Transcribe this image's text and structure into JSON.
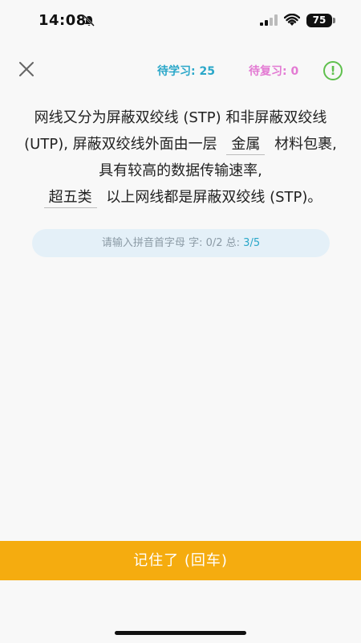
{
  "status_bar": {
    "time": "14:08",
    "battery": "75"
  },
  "header": {
    "close_icon": "close-icon",
    "to_learn": "待学习: 25",
    "to_review": "待复习: 0",
    "alert_icon": "!"
  },
  "passage": {
    "part1": "网线又分为屏蔽双绞线 (STP) 和非屏蔽双绞线 (UTP), 屏蔽双绞线外面由一层",
    "blank1": "金属",
    "part2": "材料包裹, 具有较高的数据传输速率,",
    "blank2": "超五类",
    "part3": "以上网线都是屏蔽双绞线 (STP)。"
  },
  "input": {
    "placeholder": "请输入拼音首字母",
    "char_progress": "字: 0/2",
    "total_label": "总:",
    "total_value": "3/5"
  },
  "footer": {
    "remember_label": "记住了 (回车)"
  },
  "colors": {
    "learn": "#2aa7c9",
    "review": "#e37ad3",
    "accent_green": "#5fc04d",
    "button": "#f5ac0f",
    "input_bg": "#e4f0f8"
  }
}
